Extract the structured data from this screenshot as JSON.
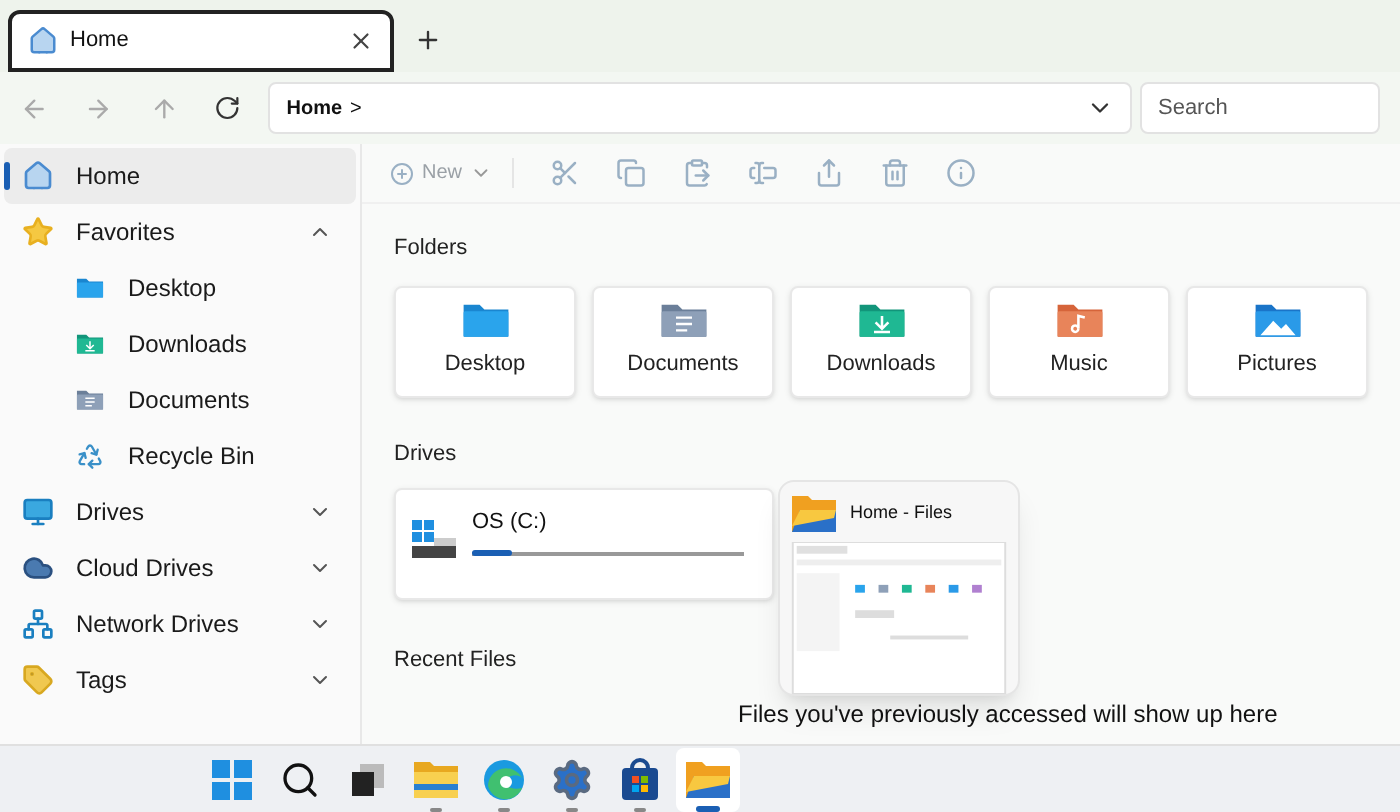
{
  "tabs": [
    {
      "label": "Home",
      "selected": true
    }
  ],
  "address": {
    "path": "Home",
    "separator": ">"
  },
  "search": {
    "placeholder": "Search"
  },
  "toolbar": {
    "new_label": "New",
    "actions": [
      {
        "kind": "cut"
      },
      {
        "kind": "copy"
      },
      {
        "kind": "paste"
      },
      {
        "kind": "rename"
      },
      {
        "kind": "share"
      },
      {
        "kind": "delete"
      },
      {
        "kind": "properties"
      }
    ]
  },
  "sidebar": {
    "items": [
      {
        "label": "Home",
        "kind": "home",
        "selected": true
      },
      {
        "label": "Favorites",
        "kind": "star",
        "selected": false,
        "expanded": true,
        "children": [
          {
            "label": "Desktop",
            "kind": "desktop",
            "selected": false
          },
          {
            "label": "Downloads",
            "kind": "downloads",
            "selected": false
          },
          {
            "label": "Documents",
            "kind": "documents",
            "selected": false
          },
          {
            "label": "Recycle Bin",
            "kind": "bin",
            "selected": false
          }
        ]
      },
      {
        "label": "Drives",
        "kind": "monitor",
        "selected": false,
        "expanded": false
      },
      {
        "label": "Cloud Drives",
        "kind": "cloud",
        "selected": false,
        "expanded": false
      },
      {
        "label": "Network Drives",
        "kind": "network",
        "selected": false,
        "expanded": false
      },
      {
        "label": "Tags",
        "kind": "tag",
        "selected": false,
        "expanded": false
      }
    ]
  },
  "folders": {
    "title": "Folders",
    "items": [
      {
        "label": "Desktop",
        "kind": "desktop"
      },
      {
        "label": "Documents",
        "kind": "documents"
      },
      {
        "label": "Downloads",
        "kind": "downloads"
      },
      {
        "label": "Music",
        "kind": "music"
      },
      {
        "label": "Pictures",
        "kind": "pictures"
      }
    ]
  },
  "drives": {
    "title": "Drives",
    "items": [
      {
        "label": "OS (C:)",
        "level": 0.15
      }
    ]
  },
  "recent": {
    "title": "Recent Files",
    "message": "Files you've previously accessed will show up here"
  },
  "preview": {
    "title": "Home - Files"
  },
  "taskbar": {
    "items": [
      {
        "kind": "start",
        "running": false,
        "selected": false
      },
      {
        "kind": "search",
        "running": false,
        "selected": false
      },
      {
        "kind": "taskview",
        "running": false,
        "selected": false
      },
      {
        "kind": "explorer",
        "running": true,
        "selected": false
      },
      {
        "kind": "edge",
        "running": true,
        "selected": false
      },
      {
        "kind": "settings",
        "running": true,
        "selected": false
      },
      {
        "kind": "store",
        "running": true,
        "selected": false
      },
      {
        "kind": "files",
        "selected": true
      }
    ]
  }
}
